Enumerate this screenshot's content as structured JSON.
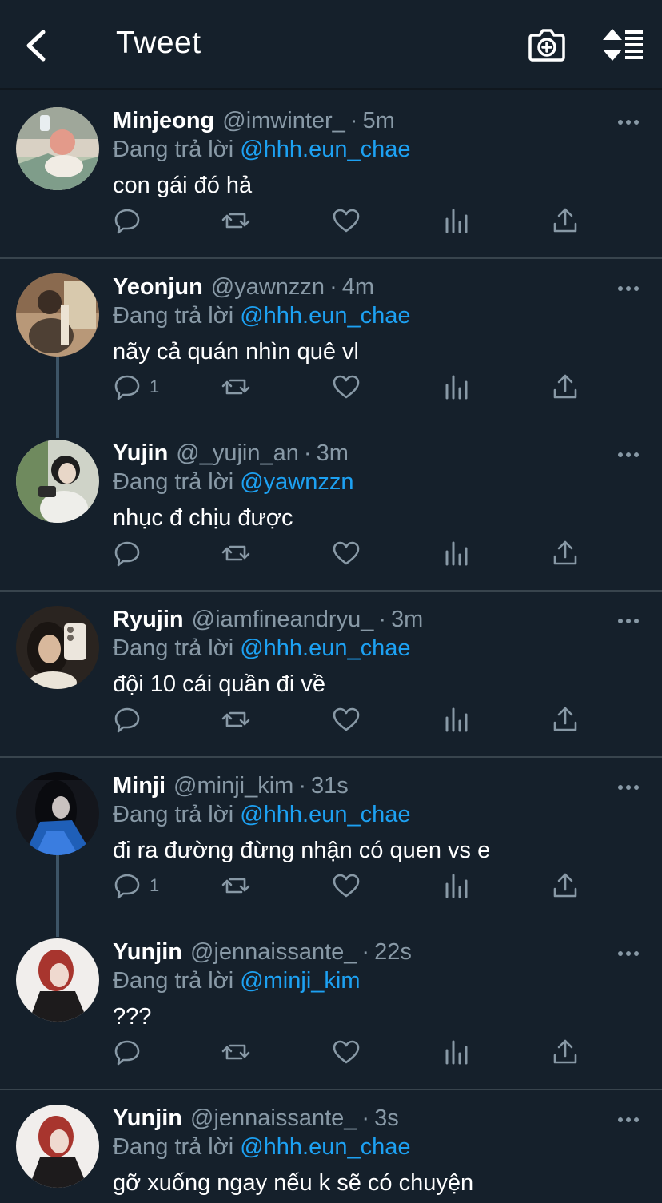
{
  "header": {
    "title": "Tweet"
  },
  "colors": {
    "background": "#15202b",
    "accent": "#1da1f2",
    "muted": "#8899a6",
    "separator": "#38444d"
  },
  "labels": {
    "replying_to": "Đang trả lời",
    "dot": "·"
  },
  "tweets": [
    {
      "name": "Minjeong",
      "handle": "@imwinter_",
      "time": "5m",
      "reply_to": "@hhh.eun_chae",
      "text": "con gái đó hả",
      "reply_count": ""
    },
    {
      "name": "Yeonjun",
      "handle": "@yawnzzn",
      "time": "4m",
      "reply_to": "@hhh.eun_chae",
      "text": "nãy cả quán nhìn quê vl",
      "reply_count": "1"
    },
    {
      "name": "Yujin",
      "handle": "@_yujin_an",
      "time": "3m",
      "reply_to": "@yawnzzn",
      "text": "nhục đ chịu được",
      "reply_count": ""
    },
    {
      "name": "Ryujin",
      "handle": "@iamfineandryu_",
      "time": "3m",
      "reply_to": "@hhh.eun_chae",
      "text": "đội 10 cái quần đi về",
      "reply_count": ""
    },
    {
      "name": "Minji",
      "handle": "@minji_kim",
      "time": "31s",
      "reply_to": "@hhh.eun_chae",
      "text": "đi ra đường đừng nhận có quen vs e",
      "reply_count": "1"
    },
    {
      "name": "Yunjin",
      "handle": "@jennaissante_",
      "time": "22s",
      "reply_to": "@minji_kim",
      "text": "???",
      "reply_count": ""
    },
    {
      "name": "Yunjin",
      "handle": "@jennaissante_",
      "time": "3s",
      "reply_to": "@hhh.eun_chae",
      "text": "gỡ xuống ngay nếu k sẽ có chuyện",
      "reply_count": ""
    }
  ]
}
